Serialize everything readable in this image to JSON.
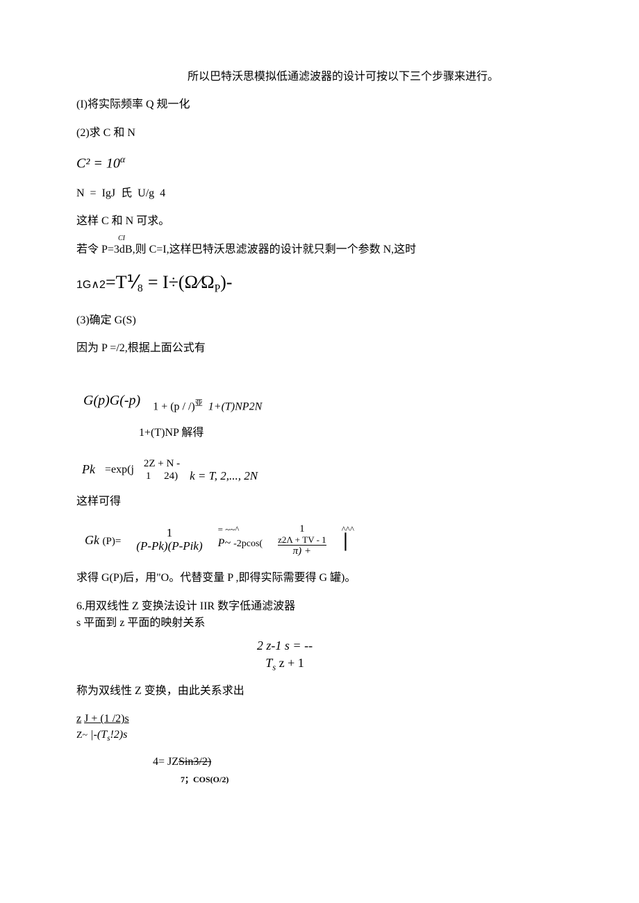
{
  "intro": "所以巴特沃思模拟低通滤波器的设计可按以下三个步骤来进行。",
  "step1": "(I)将实际频率 Q 规一化",
  "step2": "(2)求 C 和 N",
  "eq_c2": "C² = 10",
  "eq_c2_sup": "α",
  "eq_n": "N = IgJ 氏 U/g 4",
  "cn_solve": "这样 C 和 N 可求。",
  "cl": "CI",
  "p3db": "若令 P=3dB,则 C=I,这样巴特沃思滤波器的设计就只剩一个参数 N,这时",
  "big_eq_prefix": "1G∧2",
  "big_eq_mid": "=T⅟₈ = I÷",
  "big_eq_paren": "(Ω⁄Ω",
  "big_eq_sub": "P",
  "big_eq_end": ")-",
  "step3": "(3)确定 G(S)",
  "p_half": "因为 P =/2,根据上面公式有",
  "gp_left": "G(p)G(-p)",
  "gp_r1": "1 + (p / /)",
  "gp_r1_sup": "亚",
  "gp_r1_tail": "1+(T)NP2N",
  "gp_row2": "1+(T)NP 解得",
  "pk_left": "Pk",
  "pk_eq": "=exp(j",
  "pk_num": "2Z + N -",
  "pk_den1": "1",
  "pk_den2": "24)",
  "pk_tail": "k = T, 2,..., 2N",
  "so_get": "这样可得",
  "gk_left": "Gk",
  "gk_p": "(P)=",
  "gk_num1": "1",
  "gk_den1": "(P-Pk)(P-Pik)",
  "gk_mid": "= ~~^",
  "gk_den2a": "P~ ",
  "gk_den2b": "-2pcos(",
  "gk_num2": "1",
  "gk_inner_num": "z2Λ + TV - 1",
  "gk_inner_tail": "π) +",
  "gk_end": "^^^",
  "after_gp": "求得 G(P)后，用\"O。代替变量 P ,即得实际需要得 G 罐)。",
  "sec6_1": "6.用双线性 Z 变换法设计 IIR 数字低通滤波器",
  "sec6_2": "s 平面到 z 平面的映射关系",
  "center_eq_top": "2 z-1 s = --",
  "center_eq_bot": "T",
  "center_eq_bot_s": "s",
  "center_eq_bot_tail": " z + 1",
  "bilinear_text": "称为双线性 Z 变换，由此关系求出",
  "z_top_left": "z",
  "z_top": "J + (1 /2)s",
  "z_bot_left": "Z~",
  "z_bot": "|-(T",
  "z_bot_s": "s",
  "z_bot_tail": "!2)s",
  "eq4": "4= JZ",
  "eq4_strike": "Sin3/2)",
  "eq7": "7；COS(O/2)"
}
